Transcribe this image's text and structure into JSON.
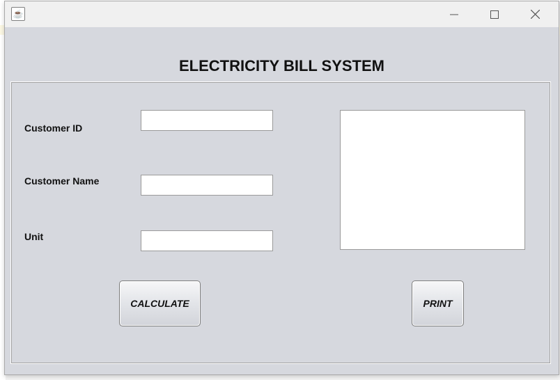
{
  "window": {
    "title": "",
    "heading": "ELECTRICITY BILL SYSTEM",
    "controls": [
      "minimize",
      "maximize",
      "close"
    ]
  },
  "form": {
    "fields": [
      {
        "label": "Customer ID",
        "value": ""
      },
      {
        "label": "Customer Name",
        "value": ""
      },
      {
        "label": "Unit",
        "value": ""
      }
    ],
    "output_text": ""
  },
  "buttons": {
    "calculate": "CALCULATE",
    "print": "PRINT"
  },
  "icons": {
    "app": "java-icon",
    "minimize": "minimize-icon",
    "maximize": "maximize-icon",
    "close": "close-icon"
  },
  "colors": {
    "window_bg": "#d6d8de",
    "titlebar_bg": "#f0f0f0"
  }
}
